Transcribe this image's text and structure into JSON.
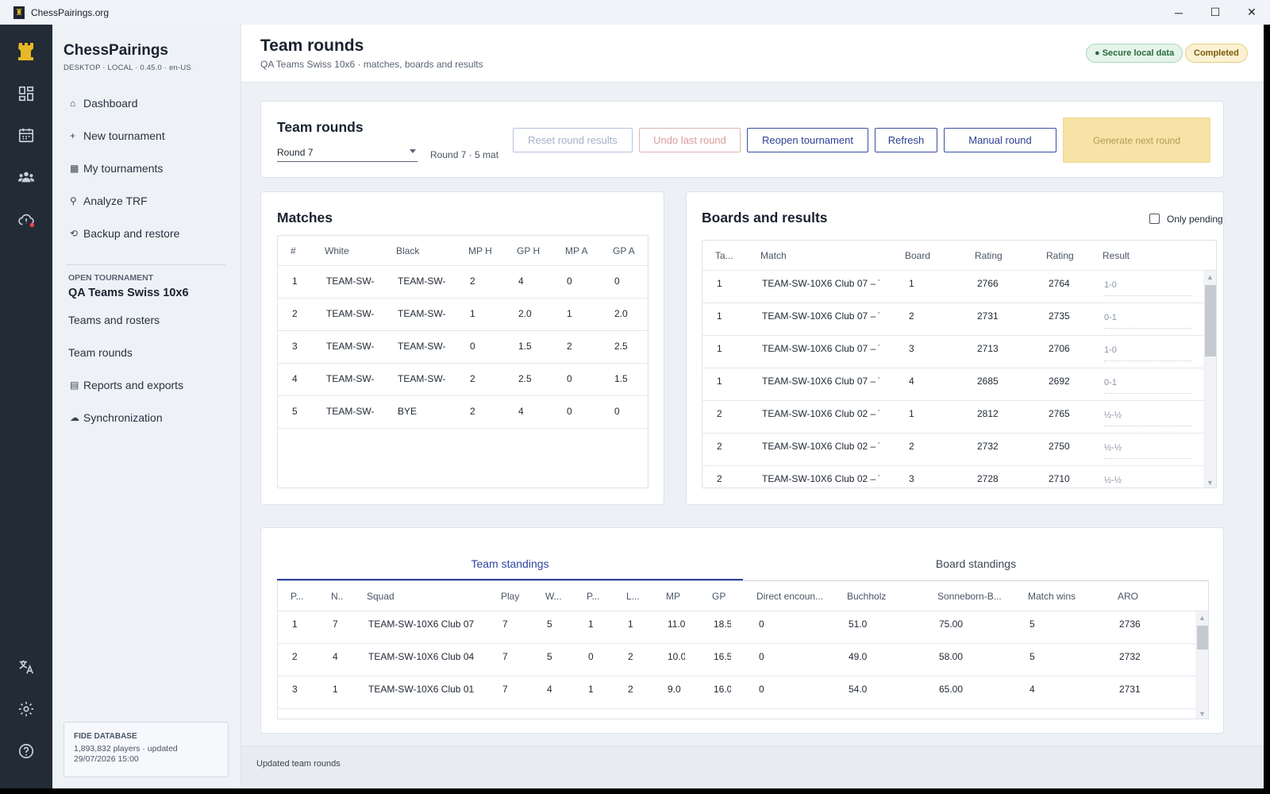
{
  "window": {
    "title": "ChessPairings.org",
    "minimize": "─",
    "maximize": "☐",
    "close": "✕"
  },
  "brand": {
    "name": "ChessPairings",
    "subtitle": "DESKTOP · LOCAL · 0.45.0 · en-US",
    "accent": "#e8b826"
  },
  "nav": [
    {
      "glyph": "⌂",
      "label": "Dashboard"
    },
    {
      "glyph": "+",
      "label": "New tournament"
    },
    {
      "glyph": "▦",
      "label": "My tournaments"
    },
    {
      "glyph": "⚲",
      "label": "Analyze TRF"
    },
    {
      "glyph": "⟲",
      "label": "Backup and restore"
    }
  ],
  "open_tournament": {
    "label": "OPEN TOURNAMENT",
    "name": "QA Teams Swiss 10x6",
    "items": [
      {
        "glyph": "",
        "label": "Teams and rosters"
      },
      {
        "glyph": "",
        "label": "Team rounds"
      },
      {
        "glyph": "▤",
        "label": "Reports and exports"
      },
      {
        "glyph": "☁",
        "label": "Synchronization"
      }
    ]
  },
  "fide": {
    "title": "FIDE DATABASE",
    "line1": "1,893,832 players · updated",
    "line2": "29/07/2026 15:00"
  },
  "header": {
    "title": "Team rounds",
    "subtitle": "QA Teams Swiss 10x6 · matches, boards and results",
    "badge_secure": "● Secure local data",
    "badge_status": "Completed"
  },
  "toolbar": {
    "title": "Team rounds",
    "round_value": "Round 7",
    "round_info": "Round 7 · 5 mat",
    "reset": "Reset round results",
    "undo": "Undo last round",
    "reopen": "Reopen tournament",
    "refresh": "Refresh",
    "manual": "Manual round",
    "generate": "Generate next round"
  },
  "matches": {
    "title": "Matches",
    "columns": [
      "#",
      "White",
      "Black",
      "MP H",
      "GP H",
      "MP A",
      "GP A"
    ],
    "rows": [
      [
        "1",
        "TEAM-SW-",
        "TEAM-SW-",
        "2",
        "4",
        "0",
        "0"
      ],
      [
        "2",
        "TEAM-SW-",
        "TEAM-SW-",
        "1",
        "2.0",
        "1",
        "2.0"
      ],
      [
        "3",
        "TEAM-SW-",
        "TEAM-SW-",
        "0",
        "1.5",
        "2",
        "2.5"
      ],
      [
        "4",
        "TEAM-SW-",
        "TEAM-SW-",
        "2",
        "2.5",
        "0",
        "1.5"
      ],
      [
        "5",
        "TEAM-SW-",
        "BYE",
        "2",
        "4",
        "0",
        "0"
      ]
    ]
  },
  "boards": {
    "title": "Boards and results",
    "only_pending": "Only pending",
    "columns": [
      "Ta...",
      "Match",
      "Board",
      "Rating",
      "Rating",
      "Result"
    ],
    "rows": [
      [
        "1",
        "TEAM-SW-10X6 Club 07 – TI",
        "1",
        "2766",
        "2764",
        "1-0"
      ],
      [
        "1",
        "TEAM-SW-10X6 Club 07 – TI",
        "2",
        "2731",
        "2735",
        "0-1"
      ],
      [
        "1",
        "TEAM-SW-10X6 Club 07 – TI",
        "3",
        "2713",
        "2706",
        "1-0"
      ],
      [
        "1",
        "TEAM-SW-10X6 Club 07 – TI",
        "4",
        "2685",
        "2692",
        "0-1"
      ],
      [
        "2",
        "TEAM-SW-10X6 Club 02 – TI",
        "1",
        "2812",
        "2765",
        "½-½"
      ],
      [
        "2",
        "TEAM-SW-10X6 Club 02 – TI",
        "2",
        "2732",
        "2750",
        "½-½"
      ],
      [
        "2",
        "TEAM-SW-10X6 Club 02 – TI",
        "3",
        "2728",
        "2710",
        "½-½"
      ]
    ]
  },
  "standings": {
    "tab_team": "Team standings",
    "tab_board": "Board standings",
    "columns": [
      "P...",
      "N..",
      "Squad",
      "Play",
      "W...",
      "P...",
      "L...",
      "MP",
      "GP",
      "Direct encoun...",
      "Buchholz",
      "Sonneborn-B...",
      "Match wins",
      "ARO"
    ],
    "rows": [
      [
        "1",
        "7",
        "TEAM-SW-10X6 Club 07",
        "7",
        "5",
        "1",
        "1",
        "11.0",
        "18.5",
        "0",
        "51.0",
        "75.00",
        "5",
        "2736"
      ],
      [
        "2",
        "4",
        "TEAM-SW-10X6 Club 04",
        "7",
        "5",
        "0",
        "2",
        "10.0",
        "16.5",
        "0",
        "49.0",
        "58.00",
        "5",
        "2732"
      ],
      [
        "3",
        "1",
        "TEAM-SW-10X6 Club 01",
        "7",
        "4",
        "1",
        "2",
        "9.0",
        "16.0",
        "0",
        "54.0",
        "65.00",
        "4",
        "2731"
      ]
    ]
  },
  "status": {
    "text": "Updated team rounds"
  },
  "icons": {
    "logo": "rook-icon",
    "rail": [
      "dashboard-icon",
      "calendar-icon",
      "people-icon",
      "cloud-alert-icon",
      "translate-icon",
      "gear-icon",
      "help-icon"
    ]
  },
  "colors": {
    "primary": "#2f44a0",
    "rail": "#232b36",
    "completed": "#fbf1d2",
    "secure": "#e5f4ea"
  }
}
